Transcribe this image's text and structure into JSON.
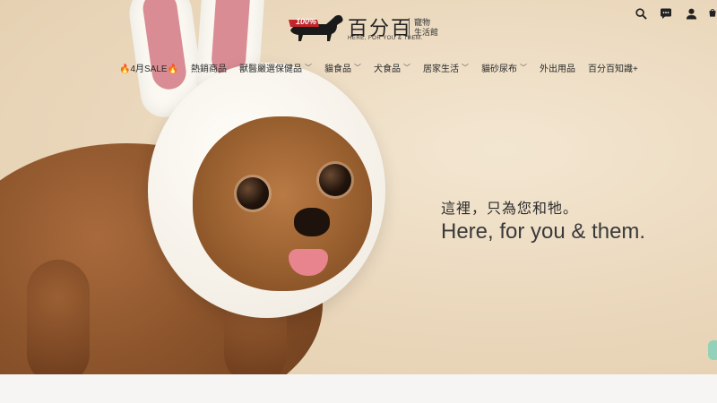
{
  "header": {
    "logo_badge": "100%",
    "brand_name": "百分百",
    "brand_tagline": "HERE, FOR YOU & THEM.",
    "brand_sub": "寵物\n生活館",
    "icons": [
      "search-icon",
      "chat-icon",
      "user-icon",
      "cart-icon"
    ]
  },
  "nav": {
    "items": [
      {
        "label": "🔥4月SALE🔥",
        "has_dropdown": false
      },
      {
        "label": "熱銷商品",
        "has_dropdown": false
      },
      {
        "label": "獸醫嚴選保健品",
        "has_dropdown": true
      },
      {
        "label": "貓食品",
        "has_dropdown": true
      },
      {
        "label": "犬食品",
        "has_dropdown": true
      },
      {
        "label": "居家生活",
        "has_dropdown": true
      },
      {
        "label": "貓砂尿布",
        "has_dropdown": true
      },
      {
        "label": "外出用品",
        "has_dropdown": false
      },
      {
        "label": "百分百知識+",
        "has_dropdown": false
      }
    ]
  },
  "hero": {
    "headline_zh": "這裡，只為您和牠。",
    "headline_en": "Here, for you & them."
  },
  "colors": {
    "hero_background": "#ead7bb",
    "logo_red": "#c0262b",
    "text_dark": "#2a2a2a"
  }
}
